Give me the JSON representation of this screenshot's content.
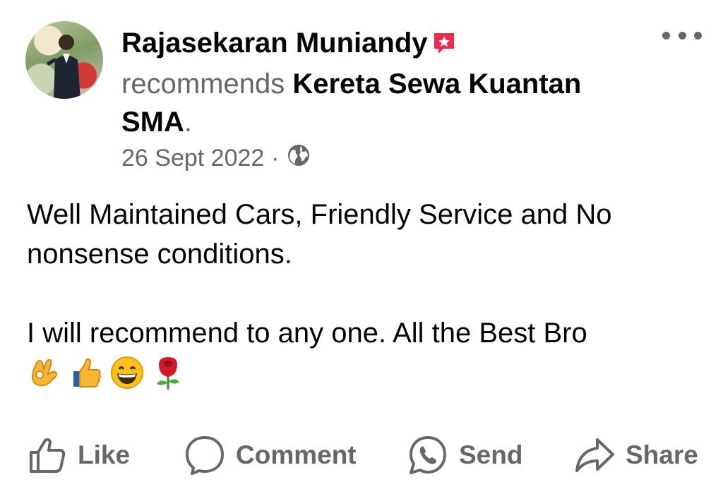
{
  "post": {
    "author_name": "Rajasekaran Muniandy",
    "action_text": "recommends",
    "page_name": "Kereta Sewa Kuantan SMA",
    "period": ".",
    "date": "26 Sept 2022",
    "separator": "·",
    "privacy_icon": "globe-icon",
    "paragraphs": [
      "Well Maintained Cars, Friendly Service and No nonsense conditions.",
      "I will recommend to any one. All the Best Bro"
    ],
    "emojis": [
      "ok-hand-emoji",
      "thumbs-up-emoji",
      "grinning-face-emoji",
      "rose-emoji"
    ]
  },
  "actions": {
    "like_label": "Like",
    "comment_label": "Comment",
    "send_label": "Send",
    "share_label": "Share"
  },
  "colors": {
    "text_primary": "#050505",
    "text_secondary": "#65676b",
    "badge": "#f02849"
  }
}
